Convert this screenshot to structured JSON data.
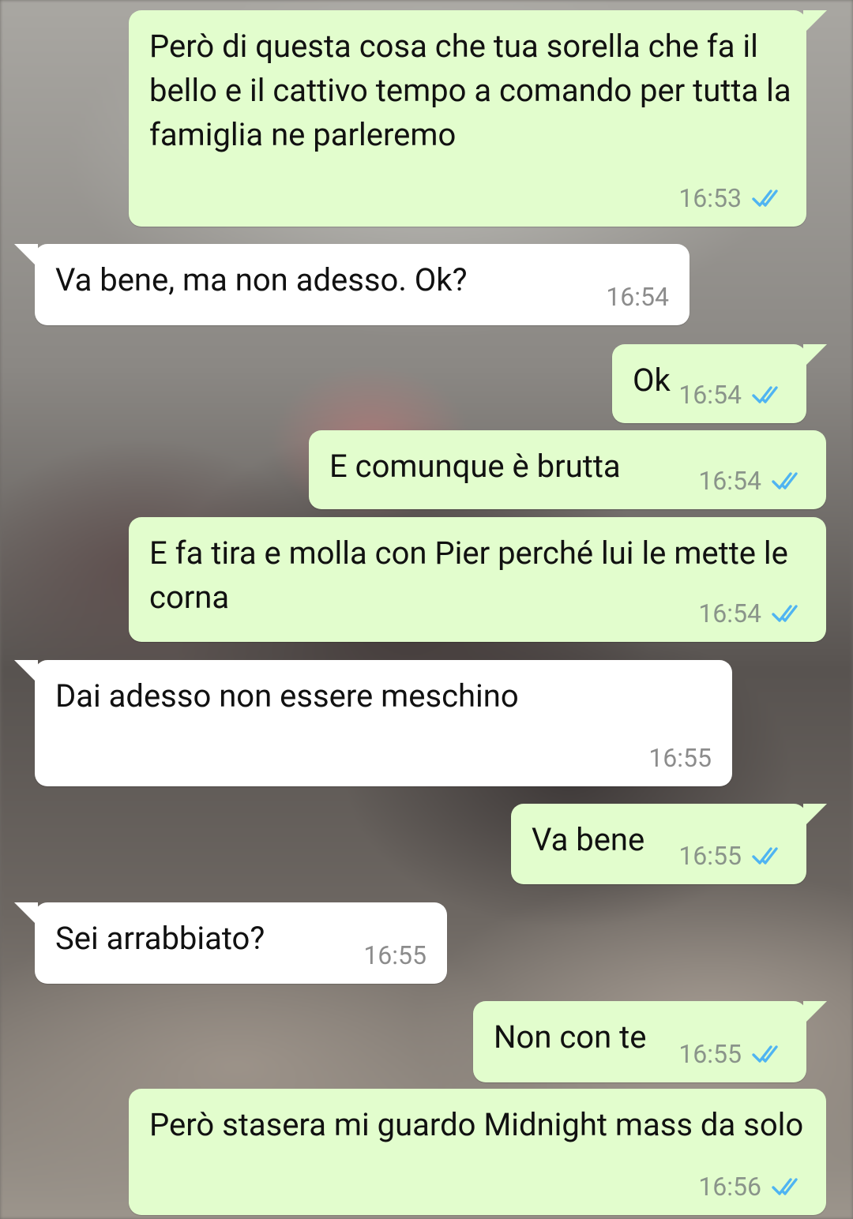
{
  "messages": [
    {
      "dir": "out",
      "text": "Però di questa cosa che tua sorella che fa il bello e il cattivo tempo a comando per tutta la famiglia ne parleremo",
      "time": "16:53",
      "status": "read-double-check-icon"
    },
    {
      "dir": "in",
      "text": "Va bene, ma non adesso. Ok?",
      "time": "16:54"
    },
    {
      "dir": "out",
      "text": "Ok",
      "time": "16:54",
      "status": "read-double-check-icon"
    },
    {
      "dir": "out",
      "text": "E comunque è brutta",
      "time": "16:54",
      "status": "read-double-check-icon"
    },
    {
      "dir": "out",
      "text": "E fa tira e molla con Pier perché lui le mette le corna",
      "time": "16:54",
      "status": "read-double-check-icon"
    },
    {
      "dir": "in",
      "text": "Dai adesso non essere meschino",
      "time": "16:55"
    },
    {
      "dir": "out",
      "text": "Va bene",
      "time": "16:55",
      "status": "read-double-check-icon"
    },
    {
      "dir": "in",
      "text": "Sei arrabbiato?",
      "time": "16:55"
    },
    {
      "dir": "out",
      "text": "Non con te",
      "time": "16:55",
      "status": "read-double-check-icon"
    },
    {
      "dir": "out",
      "text": "Però stasera mi guardo Midnight mass da solo",
      "time": "16:56",
      "status": "read-double-check-icon"
    }
  ],
  "colors": {
    "outgoing_bubble": "#e2fdcd",
    "incoming_bubble": "#ffffff",
    "read_ticks": "#4fb4f2"
  }
}
